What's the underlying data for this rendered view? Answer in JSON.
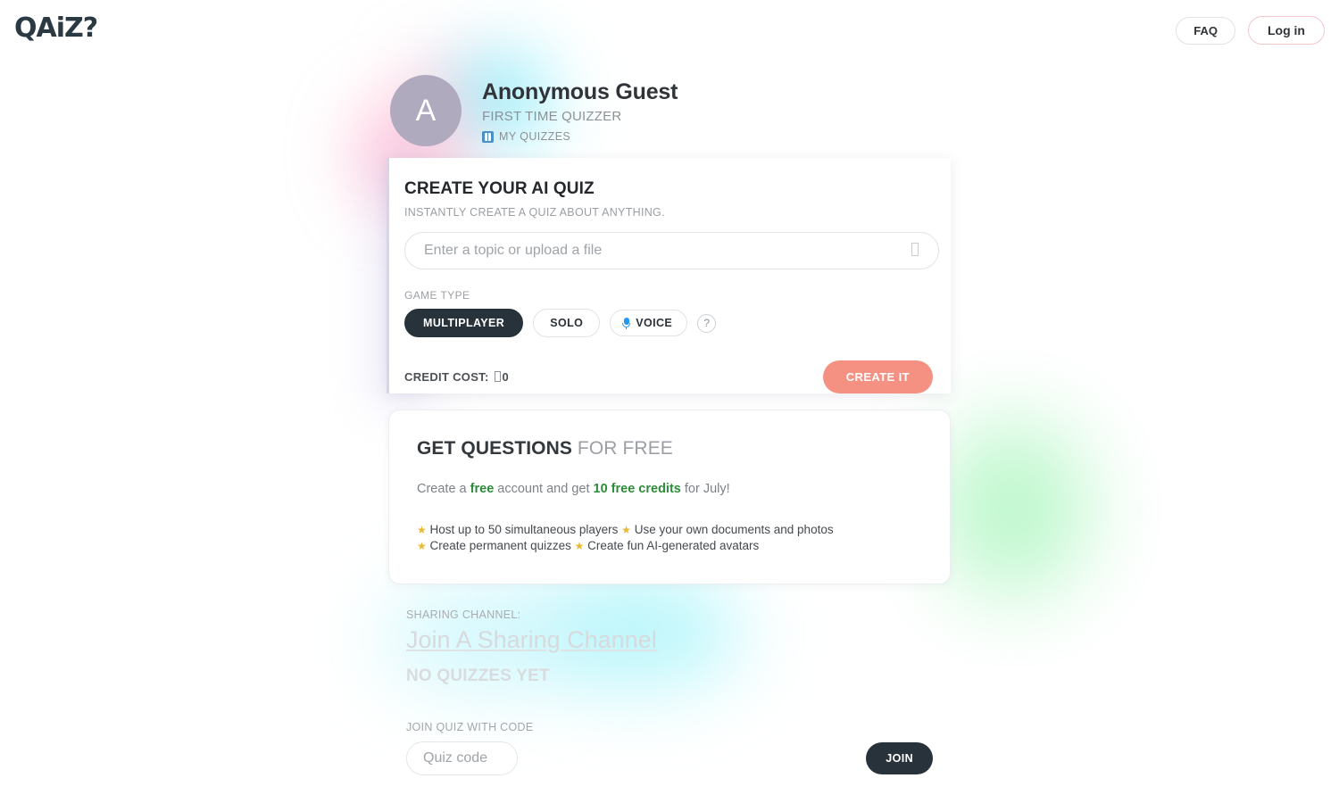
{
  "header": {
    "logo": "QAiZ?",
    "faq_label": "FAQ",
    "login_label": "Log in"
  },
  "profile": {
    "avatar_initial": "A",
    "name": "Anonymous Guest",
    "subtitle": "FIRST TIME QUIZZER",
    "my_quizzes_label": "MY QUIZZES",
    "my_quizzes_icon": "book-icon"
  },
  "create_card": {
    "title": "CREATE YOUR AI QUIZ",
    "subtitle": "INSTANTLY CREATE A QUIZ ABOUT ANYTHING.",
    "topic_placeholder": "Enter a topic or upload a file",
    "topic_value": "",
    "upload_icon": "upload-file-icon",
    "game_type_label": "GAME TYPE",
    "game_types": [
      {
        "label": "MULTIPLAYER",
        "selected": true
      },
      {
        "label": "SOLO",
        "selected": false
      },
      {
        "label": "VOICE",
        "selected": false,
        "icon": "microphone-icon"
      }
    ],
    "help_label": "?",
    "credit_cost_label": "CREDIT COST:",
    "credit_cost_value": "0",
    "create_label": "CREATE IT",
    "accent_color": "#f59183"
  },
  "free_card": {
    "title_bold": "GET QUESTIONS",
    "title_rest": " FOR FREE",
    "desc_pre": "Create a ",
    "desc_free": "free",
    "desc_mid": " account and get ",
    "desc_credits": "10 free credits",
    "desc_post": " for July!",
    "features": [
      "Host up to 50 simultaneous players",
      "Use your own documents and photos",
      "Create permanent quizzes",
      "Create fun AI-generated avatars"
    ],
    "star_color": "#e8b931",
    "highlight_color": "#2e8b3a"
  },
  "sharing": {
    "label": "SHARING CHANNEL:",
    "link_label": "Join A Sharing Channel",
    "empty_label": "NO QUIZZES YET"
  },
  "join": {
    "label": "JOIN QUIZ WITH CODE",
    "code_placeholder": "Quiz code",
    "code_value": "",
    "join_label": "JOIN"
  }
}
